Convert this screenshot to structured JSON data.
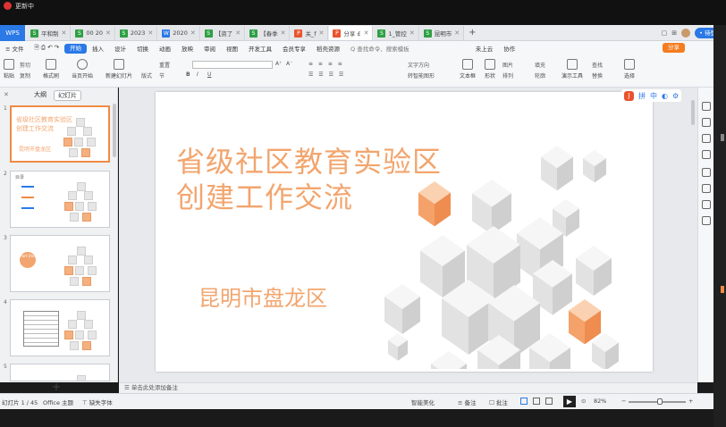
{
  "window": {
    "title": "更新中"
  },
  "tabs": {
    "wps_label": "WPS",
    "items": [
      {
        "icon": "S",
        "color": "#2ea043",
        "label": "平和制"
      },
      {
        "icon": "S",
        "color": "#2ea043",
        "label": "00 20"
      },
      {
        "icon": "S",
        "color": "#2ea043",
        "label": "2023"
      },
      {
        "icon": "W",
        "color": "#2b79e6",
        "label": "2020"
      },
      {
        "icon": "S",
        "color": "#2ea043",
        "label": "【资了"
      },
      {
        "icon": "S",
        "color": "#2ea043",
        "label": "【春季"
      },
      {
        "icon": "P",
        "color": "#e8542e",
        "label": "关_f"
      },
      {
        "icon": "P",
        "color": "#e8542e",
        "label": "分享 £",
        "active": true
      },
      {
        "icon": "S",
        "color": "#2ea043",
        "label": "1_管控"
      },
      {
        "icon": "S",
        "color": "#2ea043",
        "label": "昆明市"
      }
    ],
    "add": "+",
    "right": {
      "login": "• 待登",
      "avatar": "user-avatar"
    }
  },
  "menu": {
    "file": "≡ 文件",
    "items": [
      "开始",
      "插入",
      "设计",
      "切换",
      "动画",
      "放映",
      "审阅",
      "视图",
      "开发工具",
      "会员专享",
      "稻壳资源"
    ],
    "active": "开始",
    "search": "Q 查找命令、搜索模板",
    "cloud": "未上云",
    "collab": "协作",
    "share": "分享"
  },
  "toolbar": {
    "paste": "粘贴",
    "cut": "剪切",
    "copy": "复制",
    "format_painter": "格式刷",
    "from_start": "当页开始",
    "new_slide": "新建幻灯片",
    "layout": "版式",
    "section": "节",
    "reset": "重置",
    "font_size_up": "A⁺",
    "font_size_down": "A⁻",
    "bold": "B",
    "italic": "I",
    "underline": "U",
    "textbox": "文本框",
    "shape": "形状",
    "arrange": "排列",
    "picture": "图片",
    "fill": "填充",
    "outline": "轮廓",
    "find": "查找",
    "replace": "替换",
    "select": "选择",
    "present_tool": "演示工具",
    "convert_to_smartart": "转智能图形",
    "text_direction": "文字方向"
  },
  "panel": {
    "tab_outline": "大纲",
    "tab_slides": "幻灯片",
    "thumbs": [
      {
        "num": "1",
        "line1": "省级社区教育实验区",
        "line2": "创建工作交流",
        "line3": "昆明市盘龙区",
        "active": true
      },
      {
        "num": "2",
        "line1": "目录",
        "line2": "",
        "line3": ""
      },
      {
        "num": "3",
        "line1": "Part One",
        "line2": "",
        "line3": ""
      },
      {
        "num": "4",
        "line1": "",
        "line2": "",
        "line3": ""
      },
      {
        "num": "5",
        "line1": "",
        "line2": "",
        "line3": ""
      }
    ],
    "add": "+"
  },
  "slide": {
    "title_line1": "省级社区教育实验区",
    "title_line2": "创建工作交流",
    "subtitle": "昆明市盘龙区",
    "accent_color": "#f2a56e"
  },
  "floating_toolbar": {
    "logo": "J",
    "pinyin": "拼",
    "zh": "中"
  },
  "notes": {
    "placeholder": "单击此处添加备注"
  },
  "status": {
    "slide_info": "幻灯片 1 / 45",
    "theme": "Office 主题",
    "missing_font": "缺失字体",
    "smart_beautify": "智能美化",
    "notes": "备注",
    "comments": "批注",
    "zoom": "82%"
  }
}
